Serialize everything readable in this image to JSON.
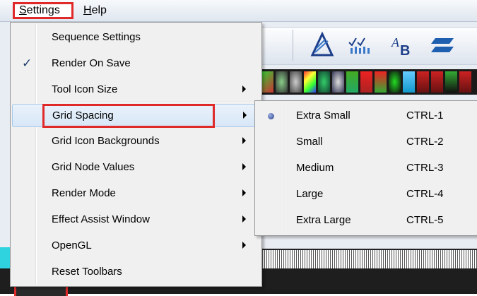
{
  "menubar": {
    "settings_label": "Settings",
    "settings_underline": "S",
    "settings_rest": "ettings",
    "help_label": "Help",
    "help_underline": "H",
    "help_rest": "elp"
  },
  "settings_menu": {
    "items": [
      {
        "label": "Sequence Settings",
        "checked": false,
        "submenu": false
      },
      {
        "label": "Render On Save",
        "checked": true,
        "submenu": false
      },
      {
        "label": "Tool Icon Size",
        "checked": false,
        "submenu": true
      },
      {
        "label": "Grid Spacing",
        "checked": false,
        "submenu": true,
        "highlighted": true
      },
      {
        "label": "Grid Icon Backgrounds",
        "checked": false,
        "submenu": true
      },
      {
        "label": "Grid Node Values",
        "checked": false,
        "submenu": true
      },
      {
        "label": "Render Mode",
        "checked": false,
        "submenu": true
      },
      {
        "label": "Effect Assist Window",
        "checked": false,
        "submenu": true
      },
      {
        "label": "OpenGL",
        "checked": false,
        "submenu": true
      },
      {
        "label": "Reset Toolbars",
        "checked": false,
        "submenu": false
      }
    ],
    "check_glyph": "✓"
  },
  "grid_spacing_submenu": {
    "items": [
      {
        "label": "Extra Small",
        "shortcut": "CTRL-1",
        "selected": true
      },
      {
        "label": "Small",
        "shortcut": "CTRL-2",
        "selected": false
      },
      {
        "label": "Medium",
        "shortcut": "CTRL-3",
        "selected": false
      },
      {
        "label": "Large",
        "shortcut": "CTRL-4",
        "selected": false
      },
      {
        "label": "Extra Large",
        "shortcut": "CTRL-5",
        "selected": false
      }
    ]
  },
  "colors": {
    "annotation_red": "#e02a2a",
    "menu_bg": "#f0f0f0",
    "highlight": "#d7e6f7"
  }
}
